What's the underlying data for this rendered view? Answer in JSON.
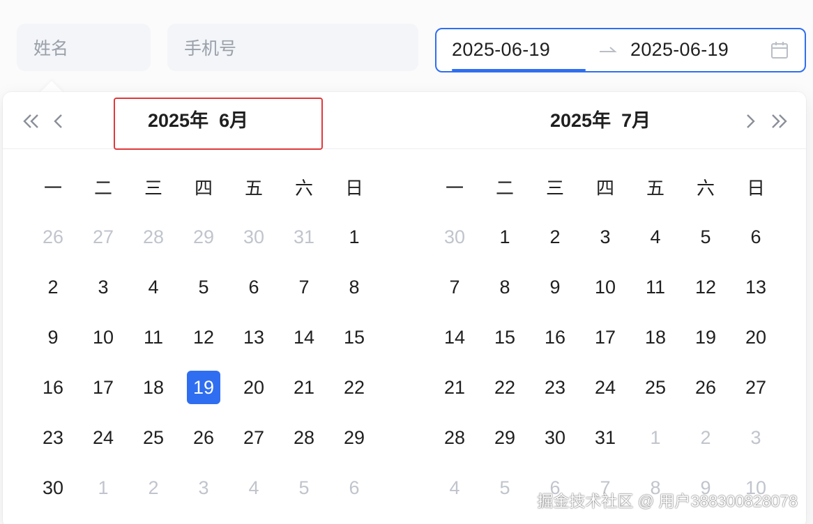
{
  "form": {
    "name_placeholder": "姓名",
    "phone_placeholder": "手机号",
    "range_start": "2025-06-19",
    "range_end": "2025-06-19"
  },
  "colors": {
    "accent": "#2f6ef0",
    "highlight": "#e0383b",
    "muted": "#c0c4cc"
  },
  "popup": {
    "left": {
      "title": "2025年  6月",
      "weekdays": [
        "一",
        "二",
        "三",
        "四",
        "五",
        "六",
        "日"
      ],
      "weeks": [
        [
          {
            "d": "26",
            "m": true
          },
          {
            "d": "27",
            "m": true
          },
          {
            "d": "28",
            "m": true
          },
          {
            "d": "29",
            "m": true
          },
          {
            "d": "30",
            "m": true
          },
          {
            "d": "31",
            "m": true
          },
          {
            "d": "1"
          }
        ],
        [
          {
            "d": "2"
          },
          {
            "d": "3"
          },
          {
            "d": "4"
          },
          {
            "d": "5"
          },
          {
            "d": "6"
          },
          {
            "d": "7"
          },
          {
            "d": "8"
          }
        ],
        [
          {
            "d": "9"
          },
          {
            "d": "10"
          },
          {
            "d": "11"
          },
          {
            "d": "12"
          },
          {
            "d": "13"
          },
          {
            "d": "14"
          },
          {
            "d": "15"
          }
        ],
        [
          {
            "d": "16"
          },
          {
            "d": "17"
          },
          {
            "d": "18"
          },
          {
            "d": "19",
            "s": true
          },
          {
            "d": "20"
          },
          {
            "d": "21"
          },
          {
            "d": "22"
          }
        ],
        [
          {
            "d": "23"
          },
          {
            "d": "24"
          },
          {
            "d": "25"
          },
          {
            "d": "26"
          },
          {
            "d": "27"
          },
          {
            "d": "28"
          },
          {
            "d": "29"
          }
        ],
        [
          {
            "d": "30"
          },
          {
            "d": "1",
            "m": true
          },
          {
            "d": "2",
            "m": true
          },
          {
            "d": "3",
            "m": true
          },
          {
            "d": "4",
            "m": true
          },
          {
            "d": "5",
            "m": true
          },
          {
            "d": "6",
            "m": true
          }
        ]
      ]
    },
    "right": {
      "title": "2025年  7月",
      "weekdays": [
        "一",
        "二",
        "三",
        "四",
        "五",
        "六",
        "日"
      ],
      "weeks": [
        [
          {
            "d": "30",
            "m": true
          },
          {
            "d": "1"
          },
          {
            "d": "2"
          },
          {
            "d": "3"
          },
          {
            "d": "4"
          },
          {
            "d": "5"
          },
          {
            "d": "6"
          }
        ],
        [
          {
            "d": "7"
          },
          {
            "d": "8"
          },
          {
            "d": "9"
          },
          {
            "d": "10"
          },
          {
            "d": "11"
          },
          {
            "d": "12"
          },
          {
            "d": "13"
          }
        ],
        [
          {
            "d": "14"
          },
          {
            "d": "15"
          },
          {
            "d": "16"
          },
          {
            "d": "17"
          },
          {
            "d": "18"
          },
          {
            "d": "19"
          },
          {
            "d": "20"
          }
        ],
        [
          {
            "d": "21"
          },
          {
            "d": "22"
          },
          {
            "d": "23"
          },
          {
            "d": "24"
          },
          {
            "d": "25"
          },
          {
            "d": "26"
          },
          {
            "d": "27"
          }
        ],
        [
          {
            "d": "28"
          },
          {
            "d": "29"
          },
          {
            "d": "30"
          },
          {
            "d": "31"
          },
          {
            "d": "1",
            "m": true
          },
          {
            "d": "2",
            "m": true
          },
          {
            "d": "3",
            "m": true
          }
        ],
        [
          {
            "d": "4",
            "m": true
          },
          {
            "d": "5",
            "m": true
          },
          {
            "d": "6",
            "m": true
          },
          {
            "d": "7",
            "m": true
          },
          {
            "d": "8",
            "m": true
          },
          {
            "d": "9",
            "m": true
          },
          {
            "d": "10",
            "m": true
          }
        ]
      ]
    }
  },
  "watermark": "掘金技术社区 @ 用户388300828078"
}
